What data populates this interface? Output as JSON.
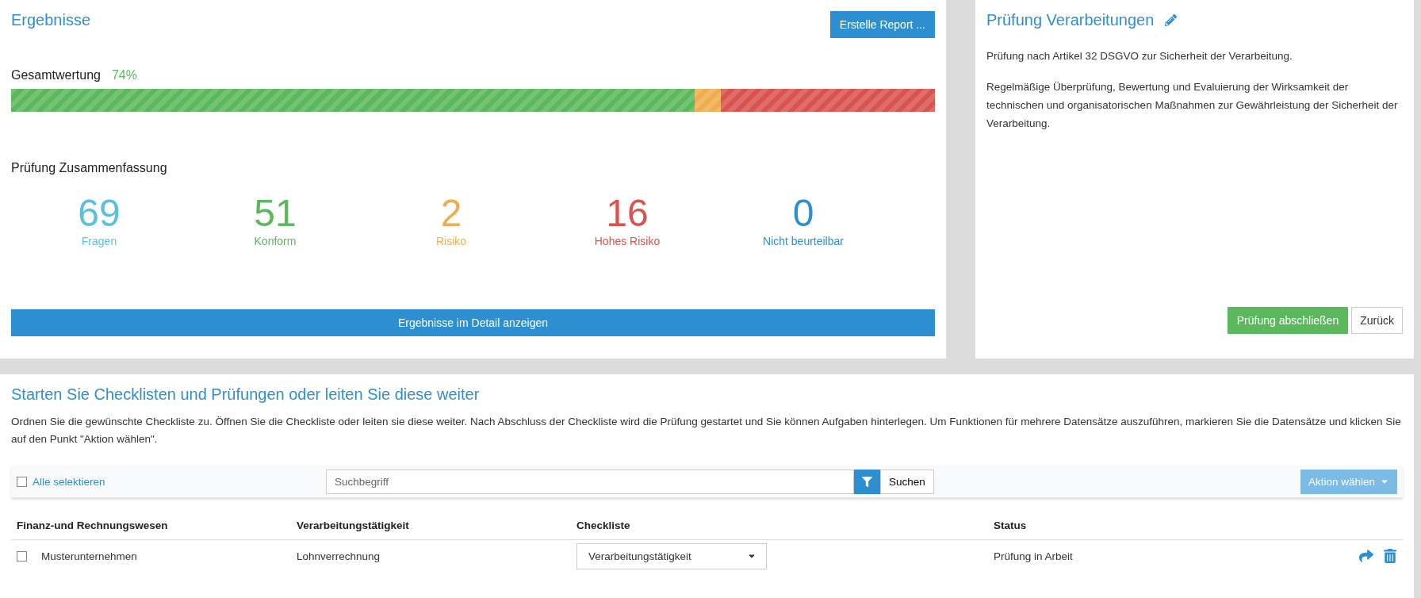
{
  "results": {
    "title": "Ergebnisse",
    "report_button": "Erstelle Report ...",
    "overall": {
      "label": "Gesamtwertung",
      "value": "74%"
    },
    "bar": {
      "color": "#d9534f",
      "segments": [
        {
          "level": 0.74,
          "color": "#5cb85c"
        },
        {
          "level": 0.768,
          "color": "#f0ad4e"
        }
      ]
    },
    "summary_title": "Prüfung Zusammenfassung",
    "stats": [
      {
        "number": "69",
        "label": "Fragen",
        "color": "#5bc0de"
      },
      {
        "number": "51",
        "label": "Konform",
        "color": "#5cb85c"
      },
      {
        "number": "2",
        "label": "Risiko",
        "color": "#f0ad4e"
      },
      {
        "number": "16",
        "label": "Hohes Risiko",
        "color": "#d9534f"
      },
      {
        "number": "0",
        "label": "Nicht beurteilbar",
        "color": "#2e8fd0"
      }
    ],
    "detail_button": "Ergebnisse im Detail anzeigen"
  },
  "audit": {
    "title": "Prüfung Verarbeitungen",
    "paragraphs": [
      "Prüfung nach Artikel 32 DSGVO zur Sicherheit der Verarbeitung.",
      "Regelmäßige Überprüfung, Bewertung und Evaluierung der Wirksamkeit der technischen und organisatorischen Maßnahmen zur Gewährleistung der Sicherheit der Verarbeitung."
    ],
    "complete_button": "Prüfung abschließen",
    "back_button": "Zurück"
  },
  "checklists": {
    "title": "Starten Sie Checklisten und Prüfungen oder leiten Sie diese weiter",
    "description": "Ordnen Sie die gewünschte Checkliste zu. Öffnen Sie die Checkliste oder leiten sie diese weiter. Nach Abschluss der Checkliste wird die Prüfung gestartet und Sie können Aufgaben hinterlegen. Um Funktionen für mehrere Datensätze auszuführen, markieren Sie die Datensätze und klicken Sie auf den Punkt \"Aktion wählen\".",
    "select_all": {
      "label": "Alle selektieren",
      "checked": false
    },
    "search": {
      "placeholder": "Suchbegriff"
    },
    "search_button": "Suchen",
    "action_button": {
      "label": "Aktion wählen",
      "disabled": true
    },
    "columns": [
      "Finanz-und Rechnungswesen",
      "Verarbeitungstätigkeit",
      "Checkliste",
      "Status"
    ],
    "rows": [
      {
        "checked": false,
        "company": "Musterunternehmen",
        "activity": "Lohnverrechnung",
        "checklist": "Verarbeitungstätigkeit",
        "status": "Prüfung in Arbeit"
      }
    ]
  }
}
